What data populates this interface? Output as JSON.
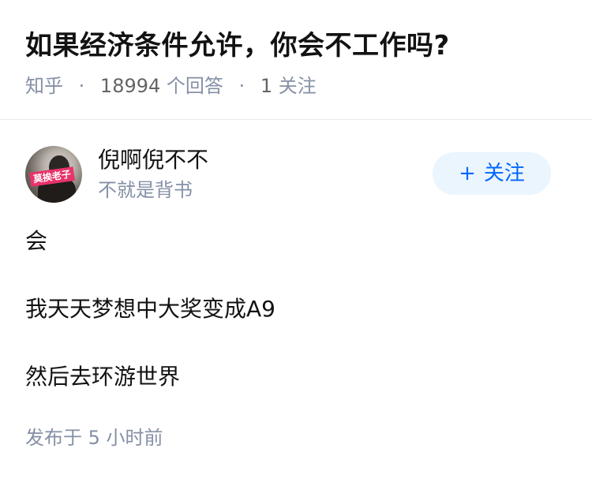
{
  "question": {
    "title": "如果经济条件允许，你会不工作吗?",
    "source": "知乎",
    "answer_count": "18994",
    "answer_label": "个回答",
    "follower_count": "1",
    "follower_label": "关注",
    "separator": "·"
  },
  "author": {
    "name": "倪啊倪不不",
    "bio": "不就是背书",
    "avatar_tag": "莫挨老子",
    "follow_plus": "+",
    "follow_label": "关注"
  },
  "answer": {
    "paragraphs": [
      "会",
      "我天天梦想中大奖变成A9",
      "然后去环游世界"
    ],
    "time_prefix": "发布于",
    "time_value": "5 小时前"
  },
  "icons": {
    "follow": "plus-icon",
    "avatar": "user-avatar"
  },
  "colors": {
    "text_primary": "#121212",
    "text_meta": "#8590a6",
    "brand_blue": "#0066ff",
    "follow_bg": "#ebf5fd",
    "avatar_tag": "#e8336b"
  }
}
